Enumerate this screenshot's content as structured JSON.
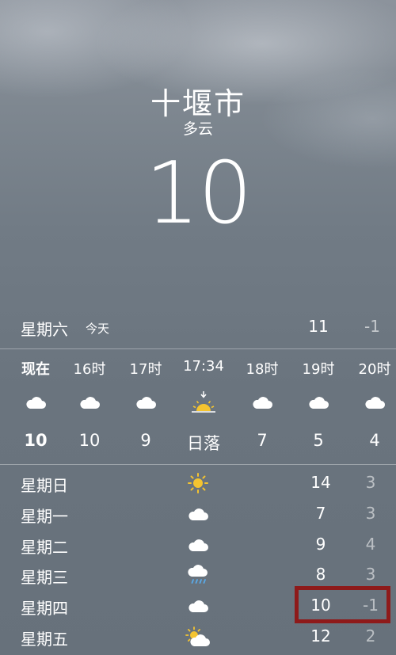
{
  "header": {
    "city": "十堰市",
    "condition": "多云",
    "current_temp": "10"
  },
  "today": {
    "day": "星期六",
    "tag": "今天",
    "high": "11",
    "low": "-1"
  },
  "hourly": [
    {
      "time": "现在",
      "icon": "cloud-icon",
      "temp": "10"
    },
    {
      "time": "16时",
      "icon": "cloud-icon",
      "temp": "10"
    },
    {
      "time": "17时",
      "icon": "cloud-icon",
      "temp": "9"
    },
    {
      "time": "17:34",
      "icon": "sunset-icon",
      "temp": "日落"
    },
    {
      "time": "18时",
      "icon": "cloud-icon",
      "temp": "7"
    },
    {
      "time": "19时",
      "icon": "cloud-icon",
      "temp": "5"
    },
    {
      "time": "20时",
      "icon": "cloud-icon",
      "temp": "4"
    }
  ],
  "daily": [
    {
      "day": "星期日",
      "icon": "sun-icon",
      "high": "14",
      "low": "3"
    },
    {
      "day": "星期一",
      "icon": "cloud-icon",
      "high": "7",
      "low": "3"
    },
    {
      "day": "星期二",
      "icon": "cloud-icon",
      "high": "9",
      "low": "4"
    },
    {
      "day": "星期三",
      "icon": "rain-cloud-icon",
      "high": "8",
      "low": "3"
    },
    {
      "day": "星期四",
      "icon": "cloud-icon",
      "high": "10",
      "low": "-1"
    },
    {
      "day": "星期五",
      "icon": "partly-sunny-icon",
      "high": "12",
      "low": "2"
    }
  ],
  "colors": {
    "highlight_border": "#8e1a1a",
    "sun": "#f4c430"
  }
}
